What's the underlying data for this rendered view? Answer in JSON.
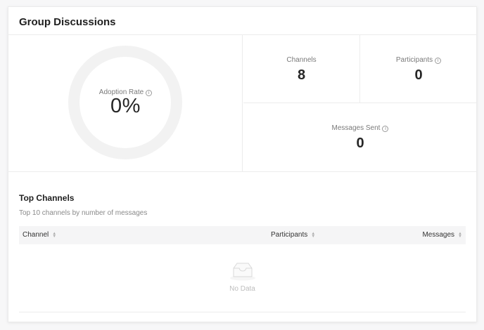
{
  "card": {
    "title": "Group Discussions"
  },
  "adoption": {
    "label": "Adoption Rate",
    "value": "0%"
  },
  "stats": {
    "channels": {
      "label": "Channels",
      "value": "8"
    },
    "participants": {
      "label": "Participants",
      "value": "0"
    },
    "messages_sent": {
      "label": "Messages Sent",
      "value": "0"
    }
  },
  "top_channels": {
    "title": "Top Channels",
    "subtitle": "Top 10 channels by number of messages",
    "columns": {
      "channel": "Channel",
      "participants": "Participants",
      "messages": "Messages"
    },
    "rows": [],
    "empty_text": "No Data"
  },
  "icons": {
    "info": "info-icon",
    "sort": "sort-icon",
    "empty": "inbox-empty-icon"
  },
  "colors": {
    "ring_track": "#f2f2f2",
    "header_bg": "#f5f5f6",
    "muted_text": "#7a7a7a"
  }
}
